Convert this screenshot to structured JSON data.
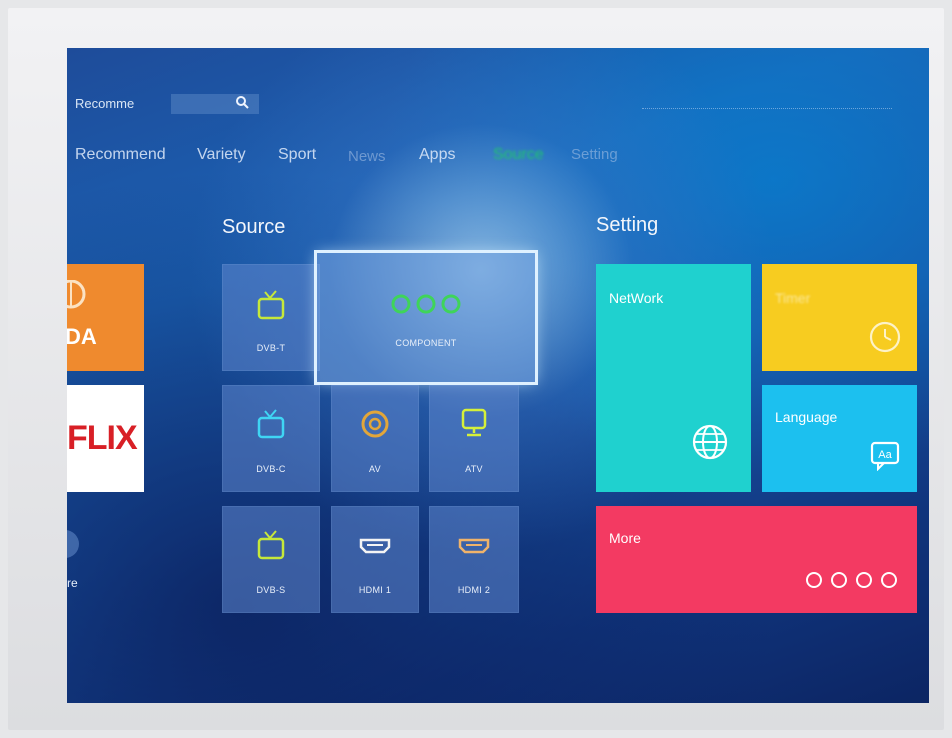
{
  "search": {
    "text": "Recomme",
    "icon": "search-icon"
  },
  "nav": {
    "tabs": [
      {
        "label": "Recommend",
        "state": "normal"
      },
      {
        "label": "Variety",
        "state": "normal"
      },
      {
        "label": "Sport",
        "state": "normal"
      },
      {
        "label": "News",
        "state": "faint"
      },
      {
        "label": "Apps",
        "state": "normal"
      },
      {
        "label": "Source",
        "state": "active"
      },
      {
        "label": "Setting",
        "state": "faint"
      }
    ],
    "active_color": "#1fc86a"
  },
  "left_apps": [
    {
      "label": "DA",
      "color": "#ef8a2e"
    },
    {
      "label": "FLIX",
      "color": "#d81f26"
    },
    {
      "label": "re"
    }
  ],
  "source": {
    "title": "Source",
    "tiles": [
      {
        "label": "DVB-T",
        "icon": "tv-icon",
        "icon_color": "#c6e83a"
      },
      {
        "label": "COMPONENT",
        "icon": "component-rca-icon",
        "icon_color": "#3fd45a"
      },
      {
        "label": "DVB-C",
        "icon": "tv-icon",
        "icon_color": "#3fd5f4"
      },
      {
        "label": "AV",
        "icon": "av-connector-icon",
        "icon_color": "#e2a63a"
      },
      {
        "label": "ATV",
        "icon": "monitor-icon",
        "icon_color": "#d5f03a"
      },
      {
        "label": "DVB-S",
        "icon": "tv-icon",
        "icon_color": "#c6e83a"
      },
      {
        "label": "HDMI 1",
        "icon": "hdmi-icon",
        "icon_color": "#f4f4f4"
      },
      {
        "label": "HDMI 2",
        "icon": "hdmi-icon",
        "icon_color": "#f0b36a"
      }
    ]
  },
  "setting": {
    "title": "Setting",
    "tiles": [
      {
        "label": "NetWork",
        "icon": "globe-icon",
        "color": "#1fd1cf"
      },
      {
        "label": "Timer",
        "icon": "clock-icon",
        "color": "#f7cc20"
      },
      {
        "label": "Language",
        "icon": "language-icon",
        "color": "#1cc0ef"
      },
      {
        "label": "More",
        "icon": "more-dots-icon",
        "color": "#f33a62"
      }
    ]
  }
}
